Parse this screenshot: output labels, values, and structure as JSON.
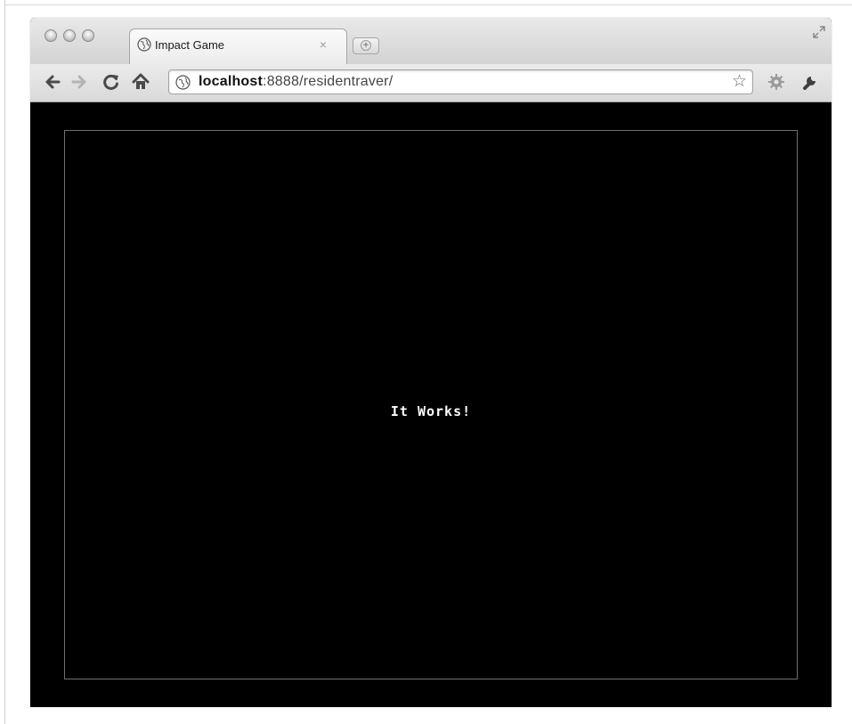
{
  "browser": {
    "tab": {
      "title": "Impact Game",
      "close_glyph": "×"
    },
    "address_bar": {
      "host": "localhost",
      "rest": ":8888/residentraver/"
    },
    "icons": {
      "back": "back-arrow-icon",
      "forward": "forward-arrow-icon",
      "reload": "reload-icon",
      "home": "home-icon",
      "page": "globe-icon",
      "bookmark": "star-icon",
      "extension": "gear-icon",
      "menu": "wrench-icon",
      "fullscreen": "fullscreen-icon"
    }
  },
  "game": {
    "message": "It Works!"
  },
  "colors": {
    "content_background": "#000000",
    "canvas_border": "#6f6f6f",
    "text": "#ffffff"
  }
}
